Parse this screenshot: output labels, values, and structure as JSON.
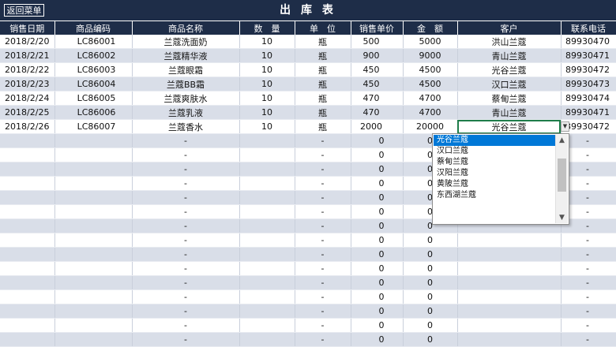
{
  "header": {
    "back_label": "返回菜单",
    "title": "出 库 表"
  },
  "columns": [
    "销售日期",
    "商品编码",
    "商品名称",
    "数　量",
    "单　位",
    "销售单价",
    "金　额",
    "客户",
    "联系电话"
  ],
  "rows": [
    [
      "2018/2/20",
      "LC86001",
      "兰蔻洗面奶",
      "10",
      "瓶",
      "500",
      "5000",
      "洪山兰蔻",
      "89930470"
    ],
    [
      "2018/2/21",
      "LC86002",
      "兰蔻精华液",
      "10",
      "瓶",
      "900",
      "9000",
      "青山兰蔻",
      "89930471"
    ],
    [
      "2018/2/22",
      "LC86003",
      "兰蔻眼霜",
      "10",
      "瓶",
      "450",
      "4500",
      "光谷兰蔻",
      "89930472"
    ],
    [
      "2018/2/23",
      "LC86004",
      "兰蔻BB霜",
      "10",
      "瓶",
      "450",
      "4500",
      "汉口兰蔻",
      "89930473"
    ],
    [
      "2018/2/24",
      "LC86005",
      "兰蔻爽肤水",
      "10",
      "瓶",
      "470",
      "4700",
      "蔡甸兰蔻",
      "89930474"
    ],
    [
      "2018/2/25",
      "LC86006",
      "兰蔻乳液",
      "10",
      "瓶",
      "470",
      "4700",
      "青山兰蔻",
      "89930471"
    ],
    [
      "2018/2/26",
      "LC86007",
      "兰蔻香水",
      "10",
      "瓶",
      "2000",
      "20000",
      "光谷兰蔻",
      "89930472"
    ]
  ],
  "empty_row": {
    "name_dash": "-",
    "unit_dash": "-",
    "price_zero": "0",
    "amount_zero": "0",
    "phone_dash": "-"
  },
  "empty_row_count": 15,
  "dropdown": {
    "options": [
      "光谷兰蔻",
      "汉口兰蔻",
      "蔡甸兰蔻",
      "汉阳兰蔻",
      "黄陂兰蔻",
      "东西湖兰蔻"
    ],
    "selected": "光谷兰蔻"
  },
  "colors": {
    "header_bg": "#1e2d48",
    "row_alt": "#d9dee8",
    "selection": "#0078d7",
    "active_cell_border": "#1f7d4a"
  },
  "icons": {
    "dropdown_arrow": "chevron-down-icon",
    "scroll_up": "chevron-up-icon",
    "scroll_down": "chevron-down-icon"
  }
}
